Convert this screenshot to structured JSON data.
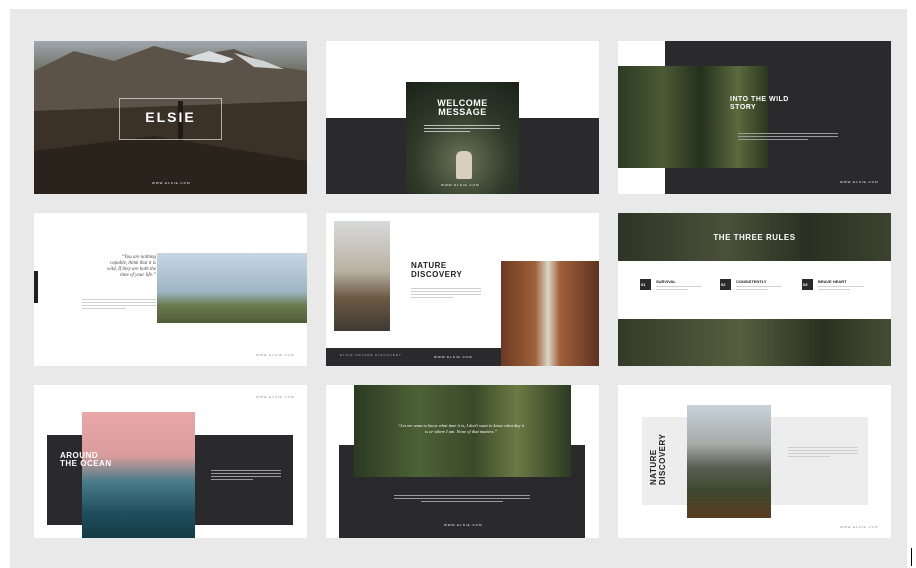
{
  "slides": {
    "s1": {
      "title": "ELSIE",
      "footer": "WWW.ELSIE.COM"
    },
    "s2": {
      "title_line1": "WELCOME",
      "title_line2": "MESSAGE",
      "footer": "WWW.ELSIE.COM"
    },
    "s3": {
      "title_line1": "INTO THE WILD",
      "title_line2": "STORY",
      "footer": "WWW.ELSIE.COM"
    },
    "s4": {
      "quote": "“You are nothing capable, think that it is wild, If they are both the time of your life.”",
      "footer": "WWW.ELSIE.COM"
    },
    "s5": {
      "title_line1": "NATURE",
      "title_line2": "DISCOVERY",
      "footer": "WWW.ELSIE.COM",
      "caption": "ELSIE NATURE DISCOVERY"
    },
    "s6": {
      "title": "THE THREE RULES",
      "rules": [
        {
          "num": "01",
          "label": "SURVIVAL"
        },
        {
          "num": "02",
          "label": "CONSISTENTLY"
        },
        {
          "num": "03",
          "label": "BRAVE HEART"
        }
      ]
    },
    "s7": {
      "title_line1": "AROUND",
      "title_line2": "THE OCEAN",
      "footer": "WWW.ELSIE.COM"
    },
    "s8": {
      "quote": "“Let me want to know what time it is, I don't want to know what day it is or where I am. None of that matters.”",
      "footer": "WWW.ELSIE.COM"
    },
    "s9": {
      "title_line1": "NATURE",
      "title_line2": "DISCOVERY",
      "footer": "WWW.ELSIE.COM"
    }
  }
}
